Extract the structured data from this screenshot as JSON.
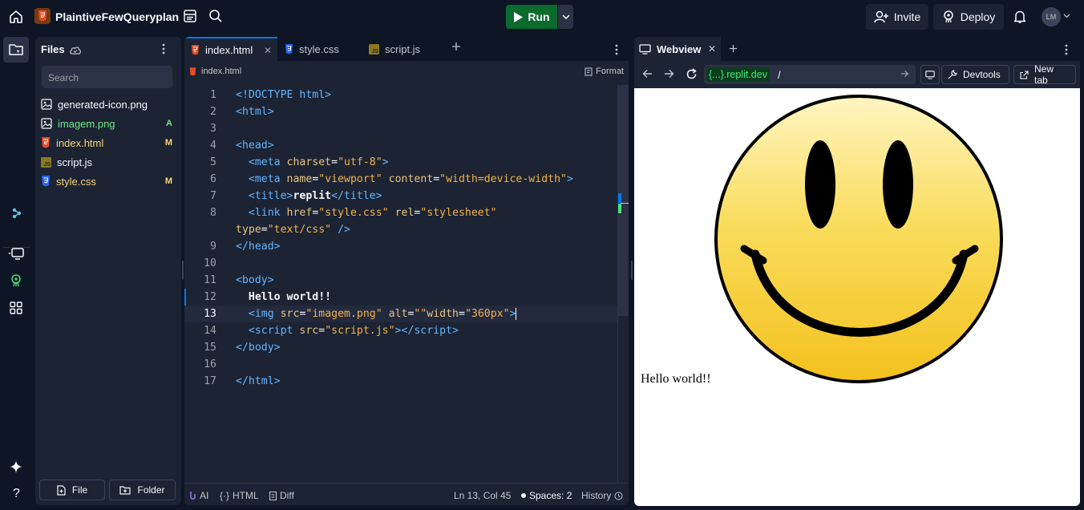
{
  "topbar": {
    "project_name": "PlaintiveFewQueryplan",
    "run_label": "Run",
    "invite_label": "Invite",
    "deploy_label": "Deploy",
    "avatar_initials": "LM"
  },
  "files_panel": {
    "title": "Files",
    "search_placeholder": "Search",
    "files": [
      {
        "name": "generated-icon.png",
        "icon": "image-icon",
        "badge": "",
        "color": "#f5f9fc"
      },
      {
        "name": "imagem.png",
        "icon": "image-icon",
        "badge": "A",
        "color": "#6ee98b"
      },
      {
        "name": "index.html",
        "icon": "html-icon",
        "badge": "M",
        "color": "#f5d67a"
      },
      {
        "name": "script.js",
        "icon": "js-icon",
        "badge": "",
        "color": "#f5f9fc"
      },
      {
        "name": "style.css",
        "icon": "css-icon",
        "badge": "M",
        "color": "#f5d67a"
      }
    ],
    "file_button": "File",
    "folder_button": "Folder"
  },
  "editor": {
    "tabs": [
      {
        "label": "index.html",
        "icon": "html-icon",
        "active": true
      },
      {
        "label": "style.css",
        "icon": "css-icon",
        "active": false
      },
      {
        "label": "script.js",
        "icon": "js-icon",
        "active": false
      }
    ],
    "breadcrumb": "index.html",
    "format_label": "Format",
    "line_numbers": [
      "1",
      "2",
      "3",
      "4",
      "5",
      "6",
      "7",
      "8",
      "",
      "9",
      "10",
      "11",
      "12",
      "13",
      "14",
      "15",
      "16",
      "17"
    ],
    "status": {
      "ai": "AI",
      "language": "HTML",
      "diff": "Diff",
      "cursor": "Ln 13, Col 45",
      "spaces": "Spaces: 2",
      "history": "History"
    }
  },
  "webview": {
    "tab_label": "Webview",
    "url_host": "{...}.replit.dev",
    "url_path": "/",
    "devtools_label": "Devtools",
    "new_tab_label": "New tab",
    "page_text": "Hello world!!"
  },
  "colors": {
    "run_green": "#0a6b2c",
    "accent_blue": "#0079f2",
    "bg": "#0e1525",
    "panel": "#1c2333"
  }
}
